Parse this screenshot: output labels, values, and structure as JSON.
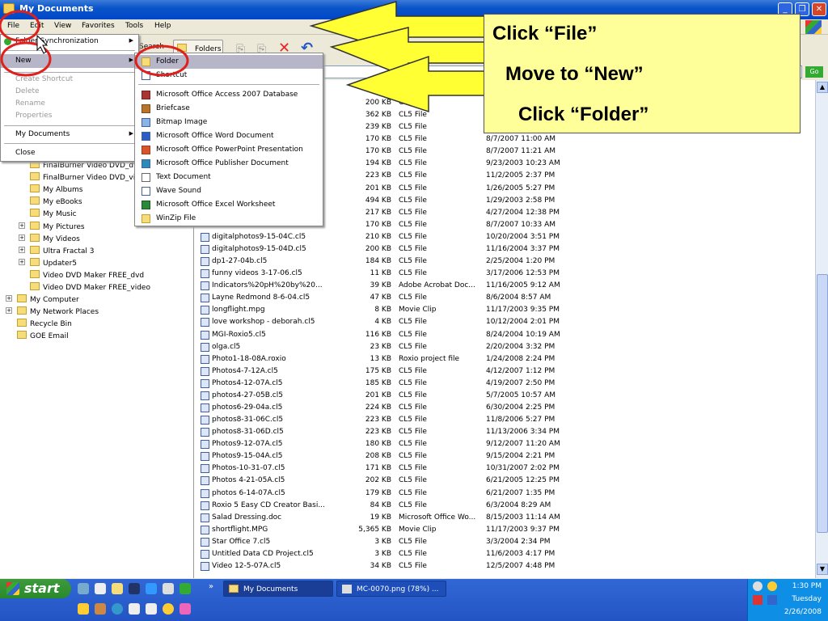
{
  "window": {
    "title": "My Documents"
  },
  "menubar": [
    "File",
    "Edit",
    "View",
    "Favorites",
    "Tools",
    "Help"
  ],
  "toolbar": {
    "search": "Search",
    "folders": "Folders"
  },
  "address": {
    "go": "Go"
  },
  "file_menu": {
    "items": [
      "Folder Synchronization",
      "New",
      "Create Shortcut",
      "Delete",
      "Rename",
      "Properties",
      "My Documents",
      "Close"
    ]
  },
  "new_menu": {
    "items": [
      "Folder",
      "Shortcut",
      "Microsoft Office Access 2007 Database",
      "Briefcase",
      "Bitmap Image",
      "Microsoft Office Word Document",
      "Microsoft Office PowerPoint Presentation",
      "Microsoft Office Publisher Document",
      "Text Document",
      "Wave Sound",
      "Microsoft Office Excel Worksheet",
      "WinZip File"
    ]
  },
  "tree": [
    {
      "label": "FinalBurner Video DVD_dvd",
      "indent": 2
    },
    {
      "label": "FinalBurner Video DVD_video",
      "indent": 2
    },
    {
      "label": "My Albums",
      "indent": 2
    },
    {
      "label": "My eBooks",
      "indent": 2
    },
    {
      "label": "My Music",
      "indent": 2
    },
    {
      "label": "My Pictures",
      "indent": 2,
      "expand": "+"
    },
    {
      "label": "My Videos",
      "indent": 2,
      "expand": "+"
    },
    {
      "label": "Ultra Fractal 3",
      "indent": 2,
      "expand": "+"
    },
    {
      "label": "Updater5",
      "indent": 2,
      "expand": "+"
    },
    {
      "label": "Video DVD Maker FREE_dvd",
      "indent": 2
    },
    {
      "label": "Video DVD Maker FREE_video",
      "indent": 2
    },
    {
      "label": "My Computer",
      "indent": 1,
      "expand": "+"
    },
    {
      "label": "My Network Places",
      "indent": 1,
      "expand": "+"
    },
    {
      "label": "Recycle Bin",
      "indent": 1
    },
    {
      "label": "GOE Email",
      "indent": 1
    }
  ],
  "files": [
    {
      "name": "",
      "size": "200 KB",
      "type": "CL5",
      "date": ""
    },
    {
      "name": "",
      "size": "362 KB",
      "type": "CL5 File",
      "date": ""
    },
    {
      "name": "",
      "size": "239 KB",
      "type": "CL5 File",
      "date": ""
    },
    {
      "name": "",
      "size": "170 KB",
      "type": "CL5 File",
      "date": "8/7/2007 11:00 AM"
    },
    {
      "name": "",
      "size": "170 KB",
      "type": "CL5 File",
      "date": "8/7/2007 11:21 AM"
    },
    {
      "name": "",
      "size": "194 KB",
      "type": "CL5 File",
      "date": "9/23/2003 10:23 AM"
    },
    {
      "name": "",
      "size": "223 KB",
      "type": "CL5 File",
      "date": "11/2/2005 2:37 PM"
    },
    {
      "name": "",
      "size": "201 KB",
      "type": "CL5 File",
      "date": "1/26/2005 5:27 PM"
    },
    {
      "name": "",
      "size": "494 KB",
      "type": "CL5 File",
      "date": "1/29/2003 2:58 PM"
    },
    {
      "name": "",
      "size": "217 KB",
      "type": "CL5 File",
      "date": "4/27/2004 12:38 PM"
    },
    {
      "name": "",
      "size": "170 KB",
      "type": "CL5 File",
      "date": "8/7/2007 10:33 AM"
    },
    {
      "name": "digitalphotos9-15-04C.cl5",
      "size": "210 KB",
      "type": "CL5 File",
      "date": "10/20/2004 3:51 PM"
    },
    {
      "name": "digitalphotos9-15-04D.cl5",
      "size": "200 KB",
      "type": "CL5 File",
      "date": "11/16/2004 3:37 PM"
    },
    {
      "name": "dp1-27-04b.cl5",
      "size": "184 KB",
      "type": "CL5 File",
      "date": "2/25/2004 1:20 PM"
    },
    {
      "name": "funny videos 3-17-06.cl5",
      "size": "11 KB",
      "type": "CL5 File",
      "date": "3/17/2006 12:53 PM"
    },
    {
      "name": "Indicators%20pH%20by%20...",
      "size": "39 KB",
      "type": "Adobe Acrobat Doc...",
      "date": "11/16/2005 9:12 AM"
    },
    {
      "name": "Layne Redmond 8-6-04.cl5",
      "size": "47 KB",
      "type": "CL5 File",
      "date": "8/6/2004 8:57 AM"
    },
    {
      "name": "longflight.mpg",
      "size": "8 KB",
      "type": "Movie Clip",
      "date": "11/17/2003 9:35 PM"
    },
    {
      "name": "love workshop - deborah.cl5",
      "size": "4 KB",
      "type": "CL5 File",
      "date": "10/12/2004 2:01 PM"
    },
    {
      "name": "MGI-Roxio5.cl5",
      "size": "116 KB",
      "type": "CL5 File",
      "date": "8/24/2004 10:19 AM"
    },
    {
      "name": "olga.cl5",
      "size": "23 KB",
      "type": "CL5 File",
      "date": "2/20/2004 3:32 PM"
    },
    {
      "name": "Photo1-18-08A.roxio",
      "size": "13 KB",
      "type": "Roxio project file",
      "date": "1/24/2008 2:24 PM"
    },
    {
      "name": "Photos4-7-12A.cl5",
      "size": "175 KB",
      "type": "CL5 File",
      "date": "4/12/2007 1:12 PM"
    },
    {
      "name": "Photos4-12-07A.cl5",
      "size": "185 KB",
      "type": "CL5 File",
      "date": "4/19/2007 2:50 PM"
    },
    {
      "name": "photos4-27-05B.cl5",
      "size": "201 KB",
      "type": "CL5 File",
      "date": "5/7/2005 10:57 AM"
    },
    {
      "name": "photos6-29-04a.cl5",
      "size": "224 KB",
      "type": "CL5 File",
      "date": "6/30/2004 2:25 PM"
    },
    {
      "name": "photos8-31-06C.cl5",
      "size": "223 KB",
      "type": "CL5 File",
      "date": "11/8/2006 5:27 PM"
    },
    {
      "name": "photos8-31-06D.cl5",
      "size": "223 KB",
      "type": "CL5 File",
      "date": "11/13/2006 3:34 PM"
    },
    {
      "name": "Photos9-12-07A.cl5",
      "size": "180 KB",
      "type": "CL5 File",
      "date": "9/12/2007 11:20 AM"
    },
    {
      "name": "Photos9-15-04A.cl5",
      "size": "208 KB",
      "type": "CL5 File",
      "date": "9/15/2004 2:21 PM"
    },
    {
      "name": "Photos-10-31-07.cl5",
      "size": "171 KB",
      "type": "CL5 File",
      "date": "10/31/2007 2:02 PM"
    },
    {
      "name": "Photos 4-21-05A.cl5",
      "size": "202 KB",
      "type": "CL5 File",
      "date": "6/21/2005 12:25 PM"
    },
    {
      "name": "photos 6-14-07A.cl5",
      "size": "179 KB",
      "type": "CL5 File",
      "date": "6/21/2007 1:35 PM"
    },
    {
      "name": "Roxio 5 Easy CD Creator Basi...",
      "size": "84 KB",
      "type": "CL5 File",
      "date": "6/3/2004 8:29 AM"
    },
    {
      "name": "Salad Dressing.doc",
      "size": "19 KB",
      "type": "Microsoft Office Wo...",
      "date": "8/15/2003 11:14 AM"
    },
    {
      "name": "shortflight.MPG",
      "size": "5,365 KB",
      "type": "Movie Clip",
      "date": "11/17/2003 9:37 PM"
    },
    {
      "name": "Star Office 7.cl5",
      "size": "3 KB",
      "type": "CL5 File",
      "date": "3/3/2004 2:34 PM"
    },
    {
      "name": "Untitled Data CD Project.cl5",
      "size": "3 KB",
      "type": "CL5 File",
      "date": "11/6/2003 4:17 PM"
    },
    {
      "name": "Video 12-5-07A.cl5",
      "size": "34 KB",
      "type": "CL5 File",
      "date": "12/5/2007 4:48 PM"
    }
  ],
  "callout": {
    "line1": "Click “File”",
    "line2": "Move to  “New”",
    "line3": "Click “Folder”"
  },
  "taskbar": {
    "start": "start",
    "tasks": [
      "My Documents",
      "MC-0070.png (78%) ..."
    ],
    "time": "1:30 PM",
    "day": "Tuesday",
    "date": "2/26/2008"
  },
  "colors": {
    "callout_bg": "#ffff99",
    "arrow_fill": "#ffff33",
    "highlight_ring": "#e0201c",
    "menu_highlight": "#b6b6c8"
  }
}
